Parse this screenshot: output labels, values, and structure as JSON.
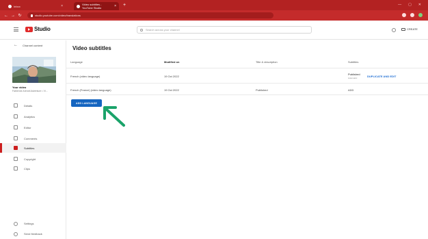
{
  "browser": {
    "tabs": [
      {
        "label": "Inbox",
        "active": false
      },
      {
        "label": "Video subtitles - YouTube Studio",
        "active": true
      }
    ],
    "url": "studio.youtube.com/video/translations",
    "accent": "#b32222"
  },
  "header": {
    "logo_text": "Studio",
    "search_placeholder": "Search across your channel",
    "create_label": "CREATE"
  },
  "sidebar": {
    "back_label": "Channel content",
    "video_title": "Your video",
    "video_subtitle": "Fabienne Arendt Adventure • Vi...",
    "items": [
      {
        "label": "Details",
        "active": false
      },
      {
        "label": "Analytics",
        "active": false
      },
      {
        "label": "Editor",
        "active": false
      },
      {
        "label": "Comments",
        "active": false
      },
      {
        "label": "Subtitles",
        "active": true
      },
      {
        "label": "Copyright",
        "active": false
      },
      {
        "label": "Clips",
        "active": false
      }
    ],
    "bottom_items": [
      {
        "label": "Settings"
      },
      {
        "label": "Send feedback"
      }
    ]
  },
  "main": {
    "title": "Video subtitles",
    "columns": [
      "Language",
      "Modified on",
      "Title & description",
      "Subtitles"
    ],
    "rows": [
      {
        "language": "French (video language)",
        "modified": "19 Oct 2022",
        "title_desc": "",
        "subtitles_status": "Published",
        "subtitles_sub": "Automatic",
        "subtitles_action": "DUPLICATE AND EDIT"
      },
      {
        "language": "French (France) (video language)",
        "modified": "19 Oct 2022",
        "title_desc": "Published",
        "subtitles_status": "ADD"
      }
    ],
    "add_language_label": "ADD LANGUAGE"
  },
  "colors": {
    "brand_red": "#cc1f1f",
    "button_blue": "#1565c0",
    "link_blue": "#1f6ed3",
    "annotation_green": "#1aa36a"
  }
}
